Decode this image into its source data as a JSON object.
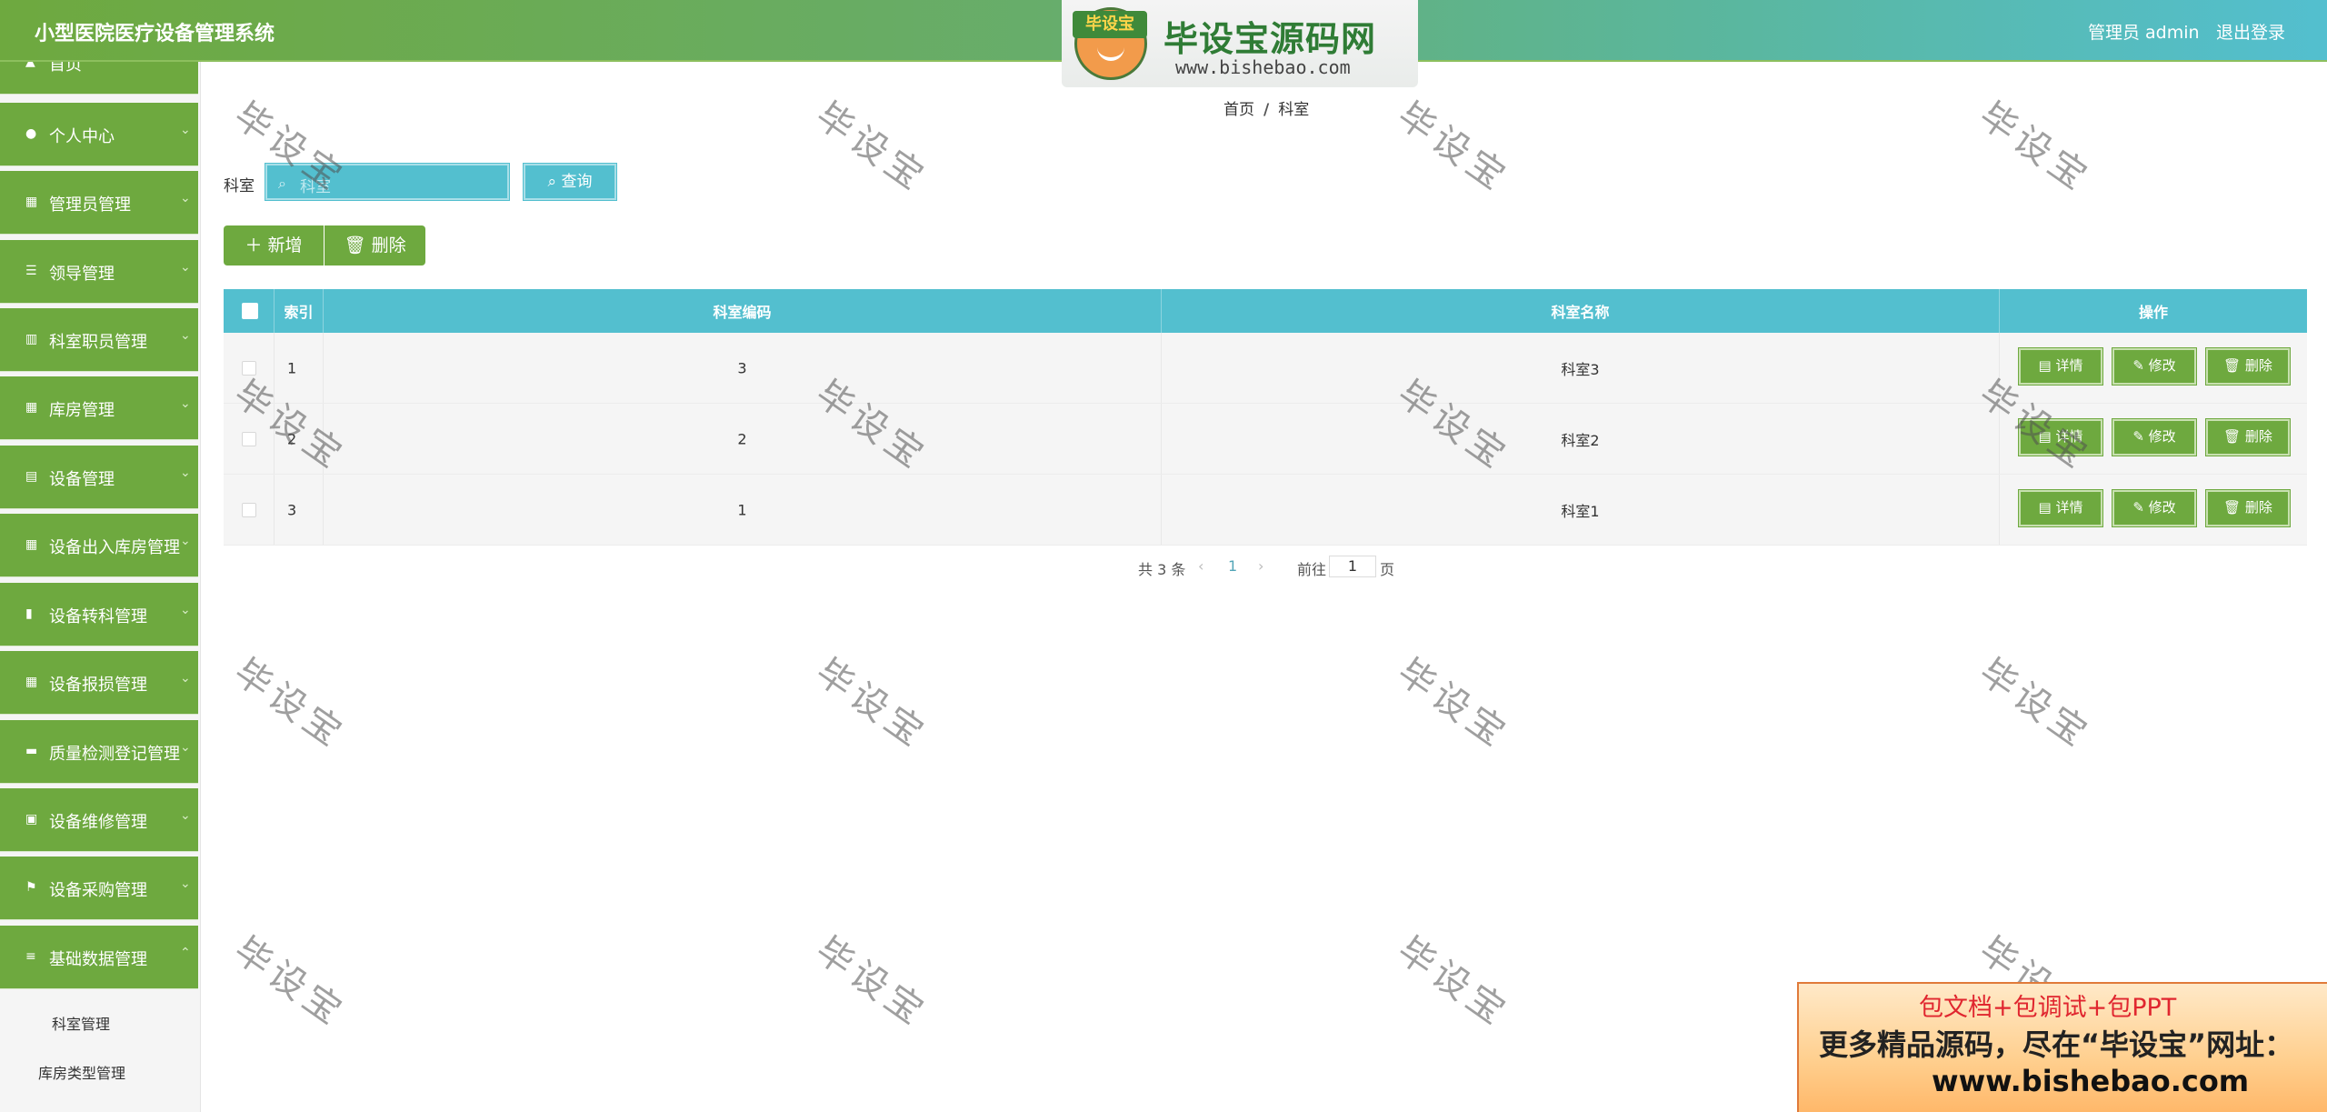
{
  "header": {
    "app_title": "小型医院医疗设备管理系统",
    "admin_label": "管理员 admin",
    "logout": "退出登录"
  },
  "logo": {
    "badge": "毕设宝",
    "name": "毕设宝源码网",
    "url": "www.bishebao.com"
  },
  "sidebar": {
    "items": [
      {
        "label": "首页",
        "icon": "home-icon"
      },
      {
        "label": "个人中心",
        "icon": "user-icon"
      },
      {
        "label": "管理员管理",
        "icon": "grid-icon"
      },
      {
        "label": "领导管理",
        "icon": "sliders-icon"
      },
      {
        "label": "科室职员管理",
        "icon": "chart-icon"
      },
      {
        "label": "库房管理",
        "icon": "grid-icon"
      },
      {
        "label": "设备管理",
        "icon": "clipboard-icon"
      },
      {
        "label": "设备出入库房管理",
        "icon": "grid-icon"
      },
      {
        "label": "设备转科管理",
        "icon": "bar-chart-icon"
      },
      {
        "label": "设备报损管理",
        "icon": "grid-icon"
      },
      {
        "label": "质量检测登记管理",
        "icon": "comment-icon"
      },
      {
        "label": "设备维修管理",
        "icon": "picture-icon"
      },
      {
        "label": "设备采购管理",
        "icon": "flag-icon"
      },
      {
        "label": "基础数据管理",
        "icon": "menu-icon"
      }
    ],
    "sub_items": [
      "科室管理",
      "库房类型管理"
    ]
  },
  "breadcrumb": {
    "home": "首页",
    "sep": "/",
    "current": "科室"
  },
  "search": {
    "label": "科室",
    "placeholder": "科室",
    "button": "查询"
  },
  "actions": {
    "add": "新增",
    "delete": "删除"
  },
  "table": {
    "headers": [
      "索引",
      "科室编码",
      "科室名称",
      "操作"
    ],
    "rows": [
      {
        "index": "1",
        "code": "3",
        "name": "科室3"
      },
      {
        "index": "2",
        "code": "2",
        "name": "科室2"
      },
      {
        "index": "3",
        "code": "1",
        "name": "科室1"
      }
    ],
    "row_actions": {
      "detail": "详情",
      "edit": "修改",
      "delete": "删除"
    }
  },
  "pagination": {
    "total": "共 3 条",
    "current_page": "1",
    "goto": "前往",
    "goto_value": "1",
    "page_unit": "页"
  },
  "watermark": "毕设宝",
  "promo": {
    "line1": "包文档+包调试+包PPT",
    "line2": "更多精品源码，尽在“毕设宝”网址：",
    "line3": "www.bishebao.com"
  },
  "colors": {
    "primary_green": "#6ea93f",
    "accent_teal": "#53bfcf"
  }
}
